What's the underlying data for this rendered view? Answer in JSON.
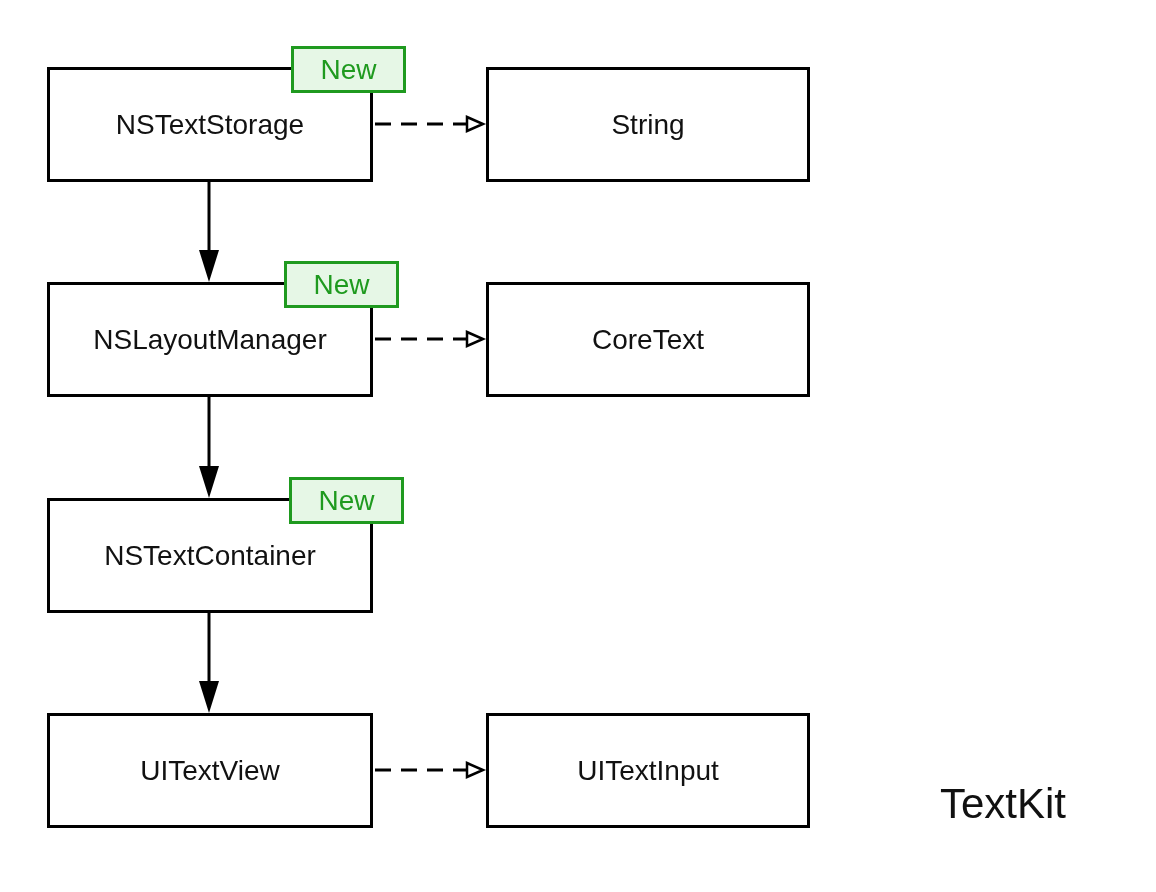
{
  "diagram": {
    "rows": [
      {
        "node": {
          "label": "NSTextStorage",
          "badge": "New"
        },
        "related": {
          "label": "String"
        }
      },
      {
        "node": {
          "label": "NSLayoutManager",
          "badge": "New"
        },
        "related": {
          "label": "CoreText"
        }
      },
      {
        "node": {
          "label": "NSTextContainer",
          "badge": "New"
        }
      },
      {
        "node": {
          "label": "UITextView"
        },
        "related": {
          "label": "UITextInput"
        }
      }
    ]
  },
  "title": "TextKit"
}
